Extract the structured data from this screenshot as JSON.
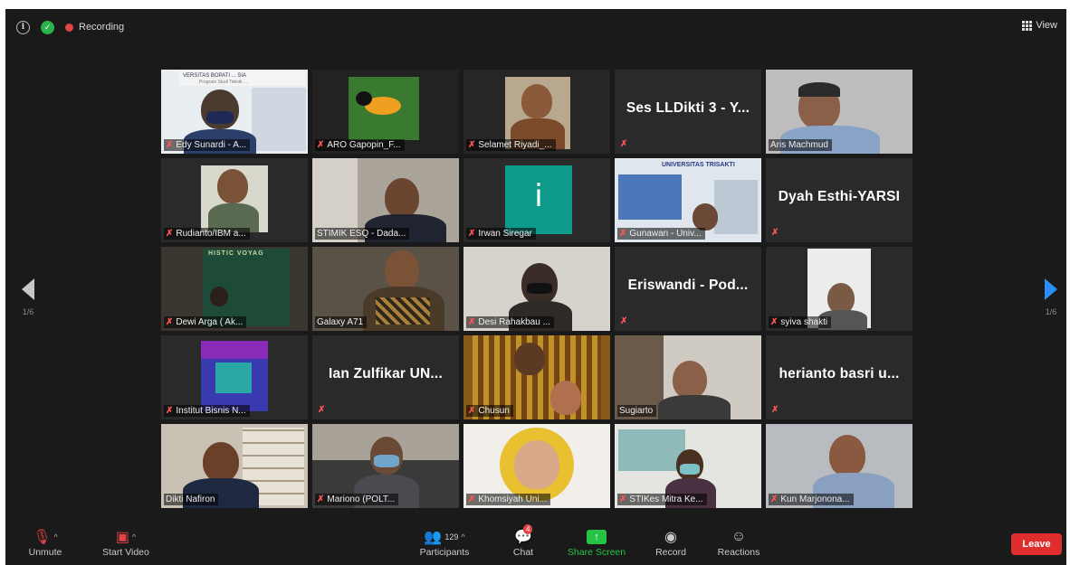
{
  "topbar": {
    "recording_label": "Recording",
    "view_label": "View"
  },
  "gallery": {
    "page_indicator_left": "1/6",
    "page_indicator_right": "1/6",
    "tiles": [
      {
        "kind": "video",
        "name": "Edy Sunardi - A..."
      },
      {
        "kind": "video",
        "name": "ARO Gapopin_F..."
      },
      {
        "kind": "video",
        "name": "Selamet Riyadi_..."
      },
      {
        "kind": "text",
        "name": "Ses LLDikti 3 - Y..."
      },
      {
        "kind": "video",
        "name": "Aris Machmud"
      },
      {
        "kind": "video",
        "name": "Rudianto/IBM a..."
      },
      {
        "kind": "video",
        "name": "STIMIK ESQ - Dada..."
      },
      {
        "kind": "video",
        "name": "Irwan Siregar"
      },
      {
        "kind": "video",
        "name": "Gunawan - Univ..."
      },
      {
        "kind": "text",
        "name": "Dyah Esthi-YARSI"
      },
      {
        "kind": "video",
        "name": "Dewi Arga ( Ak..."
      },
      {
        "kind": "video",
        "name": "Galaxy A71"
      },
      {
        "kind": "video",
        "name": "Desi Rahakbau ..."
      },
      {
        "kind": "text",
        "name": "Eriswandi - Pod..."
      },
      {
        "kind": "video",
        "name": "syiva shakti"
      },
      {
        "kind": "video",
        "name": "Institut Bisnis N..."
      },
      {
        "kind": "text",
        "name": "Ian Zulfikar UN..."
      },
      {
        "kind": "video",
        "name": "Chusun"
      },
      {
        "kind": "video",
        "name": "Sugiarto"
      },
      {
        "kind": "text",
        "name": "herianto basri u..."
      },
      {
        "kind": "video",
        "name": "Dikti Nafiron"
      },
      {
        "kind": "video",
        "name": "Mariono (POLT..."
      },
      {
        "kind": "video",
        "name": "Khomsiyah Uni..."
      },
      {
        "kind": "video",
        "name": "STIKes Mitra Ke..."
      },
      {
        "kind": "video",
        "name": "Kun Marjonona..."
      }
    ]
  },
  "tile_texts": {
    "slide_header": "VERSITAS BOPATI ... SIA",
    "slide_sub": "Program Studi Teknik ...",
    "book_title": "HISTIC VOYAG",
    "letter_i": "i",
    "trisakti": "UNIVERSITAS TRISAKTI"
  },
  "controls": {
    "unmute_label": "Unmute",
    "start_video_label": "Start Video",
    "participants_label": "Participants",
    "participants_count": "129",
    "chat_label": "Chat",
    "chat_badge": "4",
    "share_screen_label": "Share Screen",
    "record_label": "Record",
    "reactions_label": "Reactions",
    "leave_label": "Leave"
  },
  "colors": {
    "active_speaker": "#c7e03a",
    "share_green": "#26c445",
    "leave_red": "#e02e2e",
    "muted_red": "#ff5555",
    "next_arrow": "#2f8ef5"
  }
}
